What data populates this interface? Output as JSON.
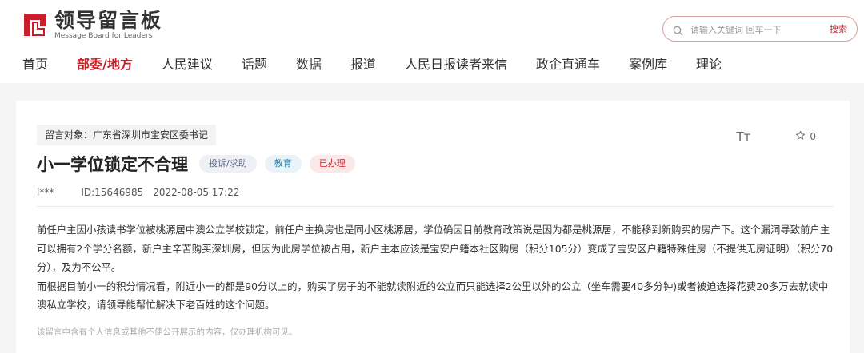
{
  "header": {
    "logo_title": "领导留言板",
    "logo_subtitle": "Message Board for Leaders",
    "search_placeholder": "请输入关键词 回车一下",
    "search_button": "搜索"
  },
  "nav": {
    "items": [
      "首页",
      "部委/地方",
      "人民建议",
      "话题",
      "数据",
      "报道",
      "人民日报读者来信",
      "政企直通车",
      "案例库",
      "理论"
    ],
    "active_index": 1
  },
  "message": {
    "target_label": "留言对象：广东省深圳市宝安区委书记",
    "title": "小一学位锁定不合理",
    "tags": {
      "type": "投诉/求助",
      "field": "教育",
      "status": "已办理"
    },
    "font_toggle_label": "Tт",
    "star_count": "0",
    "user": "l***",
    "id": "ID:15646985",
    "date": "2022-08-05 17:22",
    "paragraphs": [
      "前任户主因小孩读书学位被桃源居中澳公立学校锁定，前任户主换房也是同小区桃源居，学位确因目前教育政策说是因为都是桃源居，不能移到新购买的房产下。这个漏洞导致前户主可以拥有2个学分名额，新户主辛苦购买深圳房，但因为此房学位被占用，新户主本应该是宝安户籍本社区购房（积分105分）变成了宝安区户籍特殊住房（不提供无房证明）（积分70分），及为不公平。",
      "而根据目前小一的积分情况看，附近小一的都是90分以上的，购买了房子的不能就读附近的公立而只能选择2公里以外的公立（坐车需要40多分钟)或者被迫选择花费20多万去就读中澳私立学校，请领导能帮忙解决下老百姓的这个问题。"
    ],
    "privacy_note": "该留言中含有个人信息或其他不便公开展示的内容，仅办理机构可见。"
  },
  "colors": {
    "brand": "#c8202a"
  }
}
